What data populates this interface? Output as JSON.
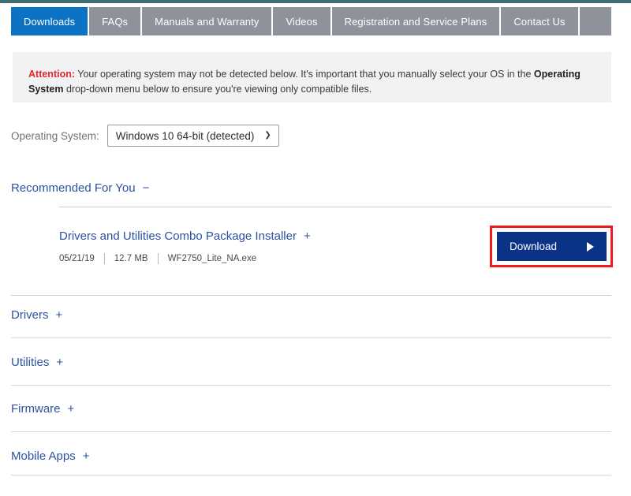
{
  "tabs": [
    {
      "label": "Downloads",
      "active": true
    },
    {
      "label": "FAQs",
      "active": false
    },
    {
      "label": "Manuals and Warranty",
      "active": false
    },
    {
      "label": "Videos",
      "active": false
    },
    {
      "label": "Registration and Service Plans",
      "active": false
    },
    {
      "label": "Contact Us",
      "active": false
    }
  ],
  "attention": {
    "label": "Attention:",
    "text_before": " Your operating system may not be detected below. It's important that you manually select your OS in the ",
    "bold_term": "Operating System",
    "text_after": " drop-down menu below to ensure you're viewing only compatible files."
  },
  "os_selector": {
    "label": "Operating System:",
    "selected": "Windows 10 64-bit (detected)",
    "caret": "chevron-down-icon"
  },
  "recommended": {
    "heading": "Recommended For You",
    "toggle": "−",
    "item": {
      "title": "Drivers and Utilities Combo Package Installer",
      "toggle": "+",
      "date": "05/21/19",
      "size": "12.7 MB",
      "filename": "WF2750_Lite_NA.exe"
    },
    "download_button": {
      "label": "Download",
      "arrow": "play-triangle-icon",
      "highlight_color": "#f01a20",
      "button_color": "#0a3287"
    }
  },
  "sections": [
    {
      "label": "Drivers",
      "toggle": "+"
    },
    {
      "label": "Utilities",
      "toggle": "+"
    },
    {
      "label": "Firmware",
      "toggle": "+"
    },
    {
      "label": "Mobile Apps",
      "toggle": "+"
    }
  ],
  "colors": {
    "active_tab": "#0c72c4",
    "inactive_tab": "#8e939b",
    "link_blue": "#2b52a4",
    "attention_red": "#e8242c",
    "top_accent": "#3f6f75"
  }
}
